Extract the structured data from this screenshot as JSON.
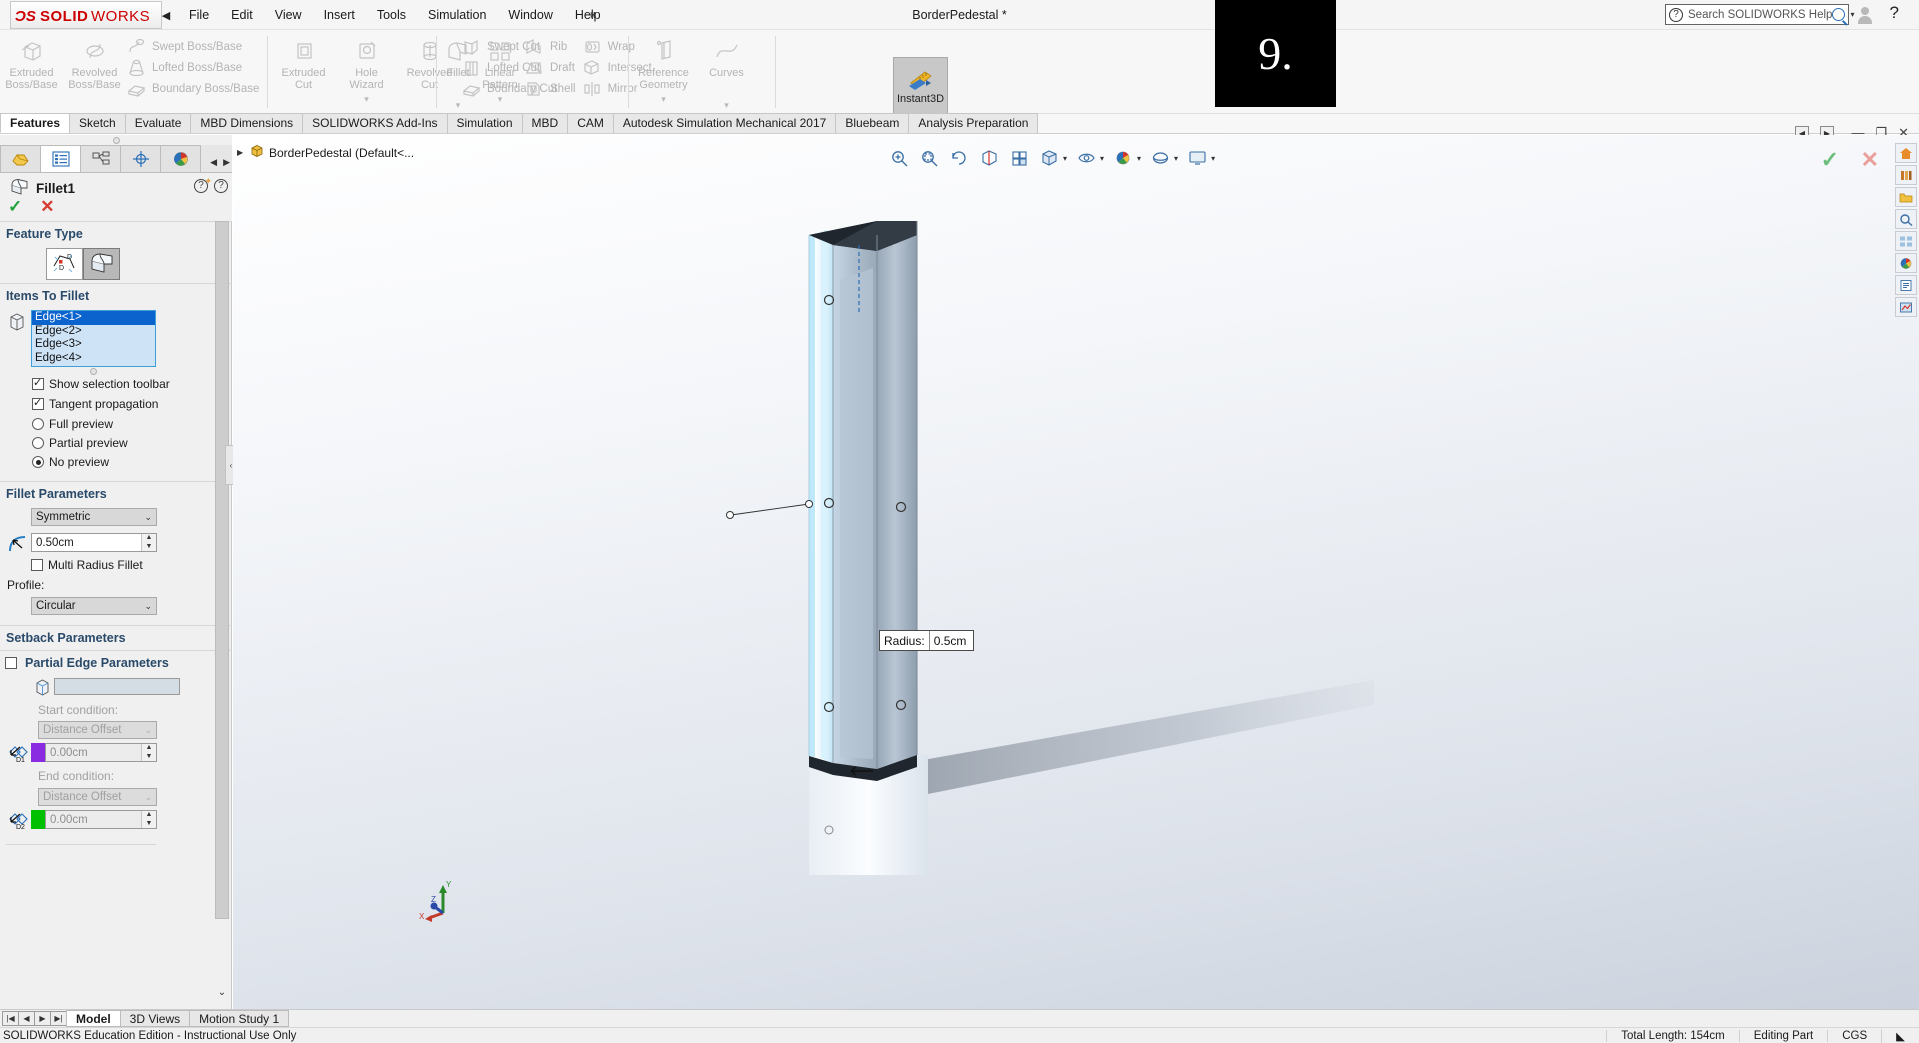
{
  "titlebar": {
    "logo_text": "SOLIDWORKS",
    "menu_collapse_icon": "caret-left-icon",
    "menu": [
      "File",
      "Edit",
      "View",
      "Insert",
      "Tools",
      "Simulation",
      "Window",
      "Help"
    ],
    "pin_icon": "pin-icon",
    "document_title": "BorderPedestal *",
    "search_icon": "question-circle-icon",
    "search_placeholder": "Search SOLIDWORKS Help",
    "search_magnifier_icon": "magnifier-icon",
    "search_caret_icon": "chevron-down-icon",
    "user_icon": "user-icon",
    "help_icon": "question-mark-icon"
  },
  "overlay": {
    "number": "9."
  },
  "ribbon": {
    "groups": [
      {
        "big": [
          {
            "label1": "Extruded",
            "label2": "Boss/Base",
            "icon": "extruded-boss-icon"
          },
          {
            "label1": "Revolved",
            "label2": "Boss/Base",
            "icon": "revolved-boss-icon"
          }
        ],
        "small": [
          {
            "label": "Swept Boss/Base",
            "icon": "swept-boss-icon"
          },
          {
            "label": "Lofted Boss/Base",
            "icon": "lofted-boss-icon"
          },
          {
            "label": "Boundary Boss/Base",
            "icon": "boundary-boss-icon"
          }
        ]
      },
      {
        "big": [
          {
            "label1": "Extruded",
            "label2": "Cut",
            "icon": "extruded-cut-icon"
          },
          {
            "label1": "Hole",
            "label2": "Wizard",
            "icon": "hole-wizard-icon",
            "caret": "▾"
          },
          {
            "label1": "Revolved",
            "label2": "Cut",
            "icon": "revolved-cut-icon"
          }
        ],
        "small": [
          {
            "label": "Swept Cut",
            "icon": "swept-cut-icon"
          },
          {
            "label": "Lofted Cut",
            "icon": "lofted-cut-icon"
          },
          {
            "label": "Boundary Cut",
            "icon": "boundary-cut-icon"
          }
        ]
      },
      {
        "big": [
          {
            "label1": "Fillet",
            "label2": "",
            "icon": "fillet-icon",
            "caret": "▾"
          },
          {
            "label1": "Linear",
            "label2": "Pattern",
            "icon": "linear-pattern-icon",
            "caret": "▾"
          }
        ],
        "small": [
          {
            "label": "Rib",
            "icon": "rib-icon"
          },
          {
            "label": "Draft",
            "icon": "draft-icon"
          },
          {
            "label": "Shell",
            "icon": "shell-icon"
          }
        ],
        "small2": [
          {
            "label": "Wrap",
            "icon": "wrap-icon"
          },
          {
            "label": "Intersect",
            "icon": "intersect-icon"
          },
          {
            "label": "Mirror",
            "icon": "mirror-icon"
          }
        ]
      },
      {
        "big": [
          {
            "label1": "Reference",
            "label2": "Geometry",
            "icon": "reference-geometry-icon",
            "caret": "▾"
          },
          {
            "label1": "Curves",
            "label2": "",
            "icon": "curves-icon",
            "caret": "▾"
          }
        ],
        "small": []
      }
    ],
    "instant3d": {
      "label": "Instant3D",
      "icon": "instant3d-icon"
    }
  },
  "ribbon_tabs": {
    "items": [
      "Features",
      "Sketch",
      "Evaluate",
      "MBD Dimensions",
      "SOLIDWORKS Add-Ins",
      "Simulation",
      "MBD",
      "CAM",
      "Autodesk Simulation Mechanical 2017",
      "Bluebeam",
      "Analysis Preparation"
    ],
    "active": "Features",
    "nav_left_icon": "chevron-left-icon",
    "nav_right_icon": "chevron-right-icon",
    "minimize_icon": "minimize-icon",
    "restore_icon": "restore-icon",
    "close_icon": "close-icon"
  },
  "left_panel": {
    "tabs": [
      {
        "icon": "feature-tree-icon",
        "name": "feature-manager"
      },
      {
        "icon": "property-manager-icon",
        "name": "property-manager"
      },
      {
        "icon": "configuration-manager-icon",
        "name": "configuration-manager"
      },
      {
        "icon": "dimxpert-icon",
        "name": "dimxpert-manager"
      },
      {
        "icon": "appearances-icon",
        "name": "display-manager"
      }
    ],
    "active_tab_index": 1,
    "property_manager": {
      "icon": "fillet-icon",
      "title": "Fillet1",
      "help_icon": "help-star-icon",
      "help2_icon": "help-icon",
      "ok_icon": "check-icon",
      "cancel_icon": "x-icon"
    },
    "feature_type": {
      "header": "Feature Type",
      "collapse_icon": "chevron-up-icon",
      "buttons": [
        {
          "name": "constant-size-fillet-button",
          "icon": "variable-size-fillet-icon",
          "selected": false
        },
        {
          "name": "face-fillet-button",
          "icon": "constant-fillet-icon",
          "selected": true
        }
      ]
    },
    "items_to_fillet": {
      "header": "Items To Fillet",
      "collapse_icon": "chevron-up-icon",
      "selection_icon": "edge-selection-icon",
      "edges": [
        "Edge<1>",
        "Edge<2>",
        "Edge<3>",
        "Edge<4>"
      ],
      "selected_edge_index": 0,
      "checkboxes": [
        {
          "label": "Show selection toolbar",
          "checked": true
        },
        {
          "label": "Tangent propagation",
          "checked": true
        }
      ],
      "radios": [
        {
          "label": "Full preview",
          "checked": false
        },
        {
          "label": "Partial preview",
          "checked": false
        },
        {
          "label": "No preview",
          "checked": true
        }
      ]
    },
    "fillet_parameters": {
      "header": "Fillet Parameters",
      "collapse_icon": "chevron-up-icon",
      "symmetry": "Symmetric",
      "radius_icon": "radius-icon",
      "radius": "0.50cm",
      "multi_radius": {
        "label": "Multi Radius Fillet",
        "checked": false
      },
      "profile_label": "Profile:",
      "profile": "Circular"
    },
    "setback_parameters": {
      "header": "Setback Parameters",
      "collapse_icon": "chevron-down-icon"
    },
    "partial_edge_parameters": {
      "header": "Partial Edge Parameters",
      "checked": false,
      "collapse_icon": "chevron-up-icon",
      "selection_icon": "edge-selection-icon",
      "selection_value": "",
      "start_condition_label": "Start condition:",
      "start_condition": "Distance Offset",
      "start_icon": "d1-dimension-icon",
      "start_color": "#8a2be2",
      "start_value": "0.00cm",
      "end_condition_label": "End condition:",
      "end_condition": "Distance Offset",
      "end_icon": "d2-dimension-icon",
      "end_color": "#00c000",
      "end_value": "0.00cm"
    },
    "scroll_down_icon": "chevron-down-icon"
  },
  "graphics": {
    "tree": {
      "expand_icon": "chevron-right-icon",
      "part_icon": "part-icon",
      "label": "BorderPedestal  (Default<..."
    },
    "heads_up_toolbar": [
      {
        "name": "zoom-to-fit-icon"
      },
      {
        "name": "zoom-to-area-icon"
      },
      {
        "name": "previous-view-icon"
      },
      {
        "name": "section-view-icon"
      },
      {
        "name": "view-orientation-icon"
      },
      {
        "name": "display-style-icon",
        "caret": "▾"
      },
      {
        "name": "hide-show-items-icon",
        "caret": "▾"
      },
      {
        "name": "edit-appearance-icon",
        "caret": "▾"
      },
      {
        "name": "apply-scene-icon",
        "caret": "▾"
      },
      {
        "name": "view-settings-icon",
        "caret": "▾"
      }
    ],
    "confirm_ok_icon": "check-icon",
    "confirm_cancel_icon": "x-icon",
    "right_tools": [
      {
        "name": "view-palette-home-icon"
      },
      {
        "name": "design-library-icon"
      },
      {
        "name": "file-explorer-icon"
      },
      {
        "name": "search-icon"
      },
      {
        "name": "view-palette-icon"
      },
      {
        "name": "appearances-icon"
      },
      {
        "name": "custom-properties-icon"
      },
      {
        "name": "simulation-icon"
      }
    ],
    "callout": {
      "label": "Radius:",
      "value": "0.5cm"
    },
    "triad": {
      "x": "X",
      "y": "Y",
      "z": "Z"
    }
  },
  "bottom": {
    "nav_icons": [
      "first-icon",
      "prev-icon",
      "next-icon",
      "last-icon"
    ],
    "tabs": [
      "Model",
      "3D Views",
      "Motion Study 1"
    ],
    "active_tab": "Model"
  },
  "status_bar": {
    "license": "SOLIDWORKS Education Edition - Instructional Use Only",
    "total_length": "Total Length: 154cm",
    "mode": "Editing Part",
    "units": "CGS",
    "resize_icon": "resize-grip-icon"
  },
  "colors": {
    "accent_blue": "#0b63ce",
    "section_header": "#2a4a6a",
    "ok_green": "#23a13c",
    "cancel_red": "#d43c32",
    "brand_red": "#cc0000"
  }
}
